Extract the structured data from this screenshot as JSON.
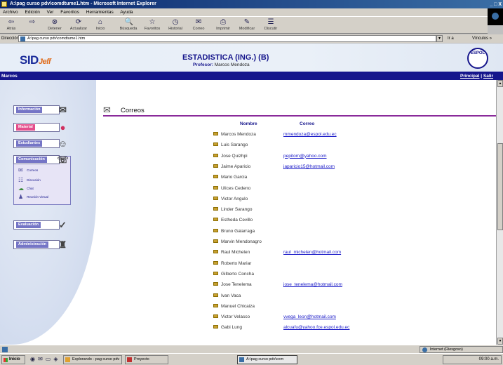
{
  "window": {
    "title": "A:\\pag curso pdv\\comdtume1.htm - Microsoft Internet Explorer",
    "controls": "_ □ X"
  },
  "menu": [
    "Archivo",
    "Edición",
    "Ver",
    "Favoritos",
    "Herramientas",
    "Ayuda"
  ],
  "toolbar": {
    "buttons": [
      {
        "label": "Atrás",
        "icon": "back-arrow-icon",
        "glyph": "⇦"
      },
      {
        "label": "",
        "icon": "forward-arrow-icon",
        "glyph": "⇨"
      },
      {
        "label": "Detener",
        "icon": "stop-icon",
        "glyph": "⊗"
      },
      {
        "label": "Actualizar",
        "icon": "refresh-icon",
        "glyph": "⟳"
      },
      {
        "label": "Inicio",
        "icon": "home-icon",
        "glyph": "⌂"
      },
      {
        "label": "Búsqueda",
        "icon": "search-icon",
        "glyph": "🔍"
      },
      {
        "label": "Favoritos",
        "icon": "favorites-icon",
        "glyph": "☆"
      },
      {
        "label": "Historial",
        "icon": "history-icon",
        "glyph": "◷"
      },
      {
        "label": "Correo",
        "icon": "mail-icon",
        "glyph": "✉"
      },
      {
        "label": "Imprimir",
        "icon": "print-icon",
        "glyph": "⎙"
      },
      {
        "label": "Modificar",
        "icon": "edit-icon",
        "glyph": "✎"
      },
      {
        "label": "Discutir",
        "icon": "discuss-icon",
        "glyph": "☰"
      }
    ]
  },
  "address": {
    "label": "Dirección",
    "value": "A:\\pag curso pdv\\comdtume1.htm",
    "go": "Ir a",
    "links": "Vínculos »"
  },
  "header": {
    "logo": "SID",
    "logo_sup": "Jeff",
    "course": "ESTADISTICA (ING.) (B)",
    "prof_label": "Profesor:",
    "prof_name": "Marcos Mendoza",
    "seal": "ESPOL"
  },
  "navstrip": {
    "left": "Marcos",
    "principal": "Principal",
    "sep": " | ",
    "salir": "Salir"
  },
  "sidebar": {
    "items": [
      {
        "label": "Información",
        "icon": "info-icon",
        "glyph": "✉",
        "style": "blue"
      },
      {
        "label": "Material",
        "icon": "material-icon",
        "glyph": "●",
        "style": "pink"
      },
      {
        "label": "Estudiantes",
        "icon": "students-icon",
        "glyph": "☺",
        "style": "blue"
      },
      {
        "label": "Comunicación",
        "icon": "communication-icon",
        "glyph": "☏",
        "style": "blue"
      },
      {
        "label": "Evaluación",
        "icon": "evaluation-icon",
        "glyph": "✓",
        "style": "blue"
      },
      {
        "label": "Administración",
        "icon": "admin-icon",
        "glyph": "♜",
        "style": "blue"
      }
    ],
    "submenu": [
      {
        "label": "Correos",
        "icon": "mail-submenu-icon",
        "glyph": "✉"
      },
      {
        "label": "Discusión",
        "icon": "discussion-icon",
        "glyph": "☷"
      },
      {
        "label": "Chat",
        "icon": "chat-icon",
        "glyph": "☁"
      },
      {
        "label": "Reunión Virtual",
        "icon": "meeting-icon",
        "glyph": "♟"
      }
    ]
  },
  "content": {
    "title": "Correos",
    "col_name": "Nombre",
    "col_mail": "Correo",
    "rows": [
      {
        "name": "Marcos Mendoza",
        "mail": "mmendoza@espol.edu.ec"
      },
      {
        "name": "Luis Sarango",
        "mail": ""
      },
      {
        "name": "Jose Quizhpi",
        "mail": "pepitom@yahoo.com"
      },
      {
        "name": "Jaime Aparicio",
        "mail": "japaricio15@hotmail.com"
      },
      {
        "name": "Mario Garcia",
        "mail": ""
      },
      {
        "name": "Ulices Cedeno",
        "mail": ""
      },
      {
        "name": "Victor Angulo",
        "mail": ""
      },
      {
        "name": "Linder Sarango",
        "mail": ""
      },
      {
        "name": "Estheda Cevillo",
        "mail": ""
      },
      {
        "name": "Bruno Galarraga",
        "mail": ""
      },
      {
        "name": "Marvin Mendonagro",
        "mail": ""
      },
      {
        "name": "Raul Michelen",
        "mail": "raul_michelen@hotmail.com"
      },
      {
        "name": "Roberto Mariar",
        "mail": ""
      },
      {
        "name": "Gilberto Concha",
        "mail": ""
      },
      {
        "name": "Jose Tenelema",
        "mail": "jose_tenelema@hotmail.com"
      },
      {
        "name": "Ivan Vaca",
        "mail": ""
      },
      {
        "name": "Manuel Chicaiza",
        "mail": ""
      },
      {
        "name": "Victor Velasco",
        "mail": "vvega_leon@hotmail.com"
      },
      {
        "name": "Gabi Lung",
        "mail": "alcuafu@yahoo.fce.espol.edu.ec"
      }
    ]
  },
  "status": {
    "left": "",
    "zone": "Internet (Riesgoso)"
  },
  "taskbar": {
    "start": "Inicio",
    "tasks": [
      {
        "label": "Explorando - pag curso pdv"
      },
      {
        "label": "Proyecto"
      },
      {
        "label": "A:\\pag curso pdv\\com"
      }
    ],
    "clock": "09:00 a.m."
  }
}
